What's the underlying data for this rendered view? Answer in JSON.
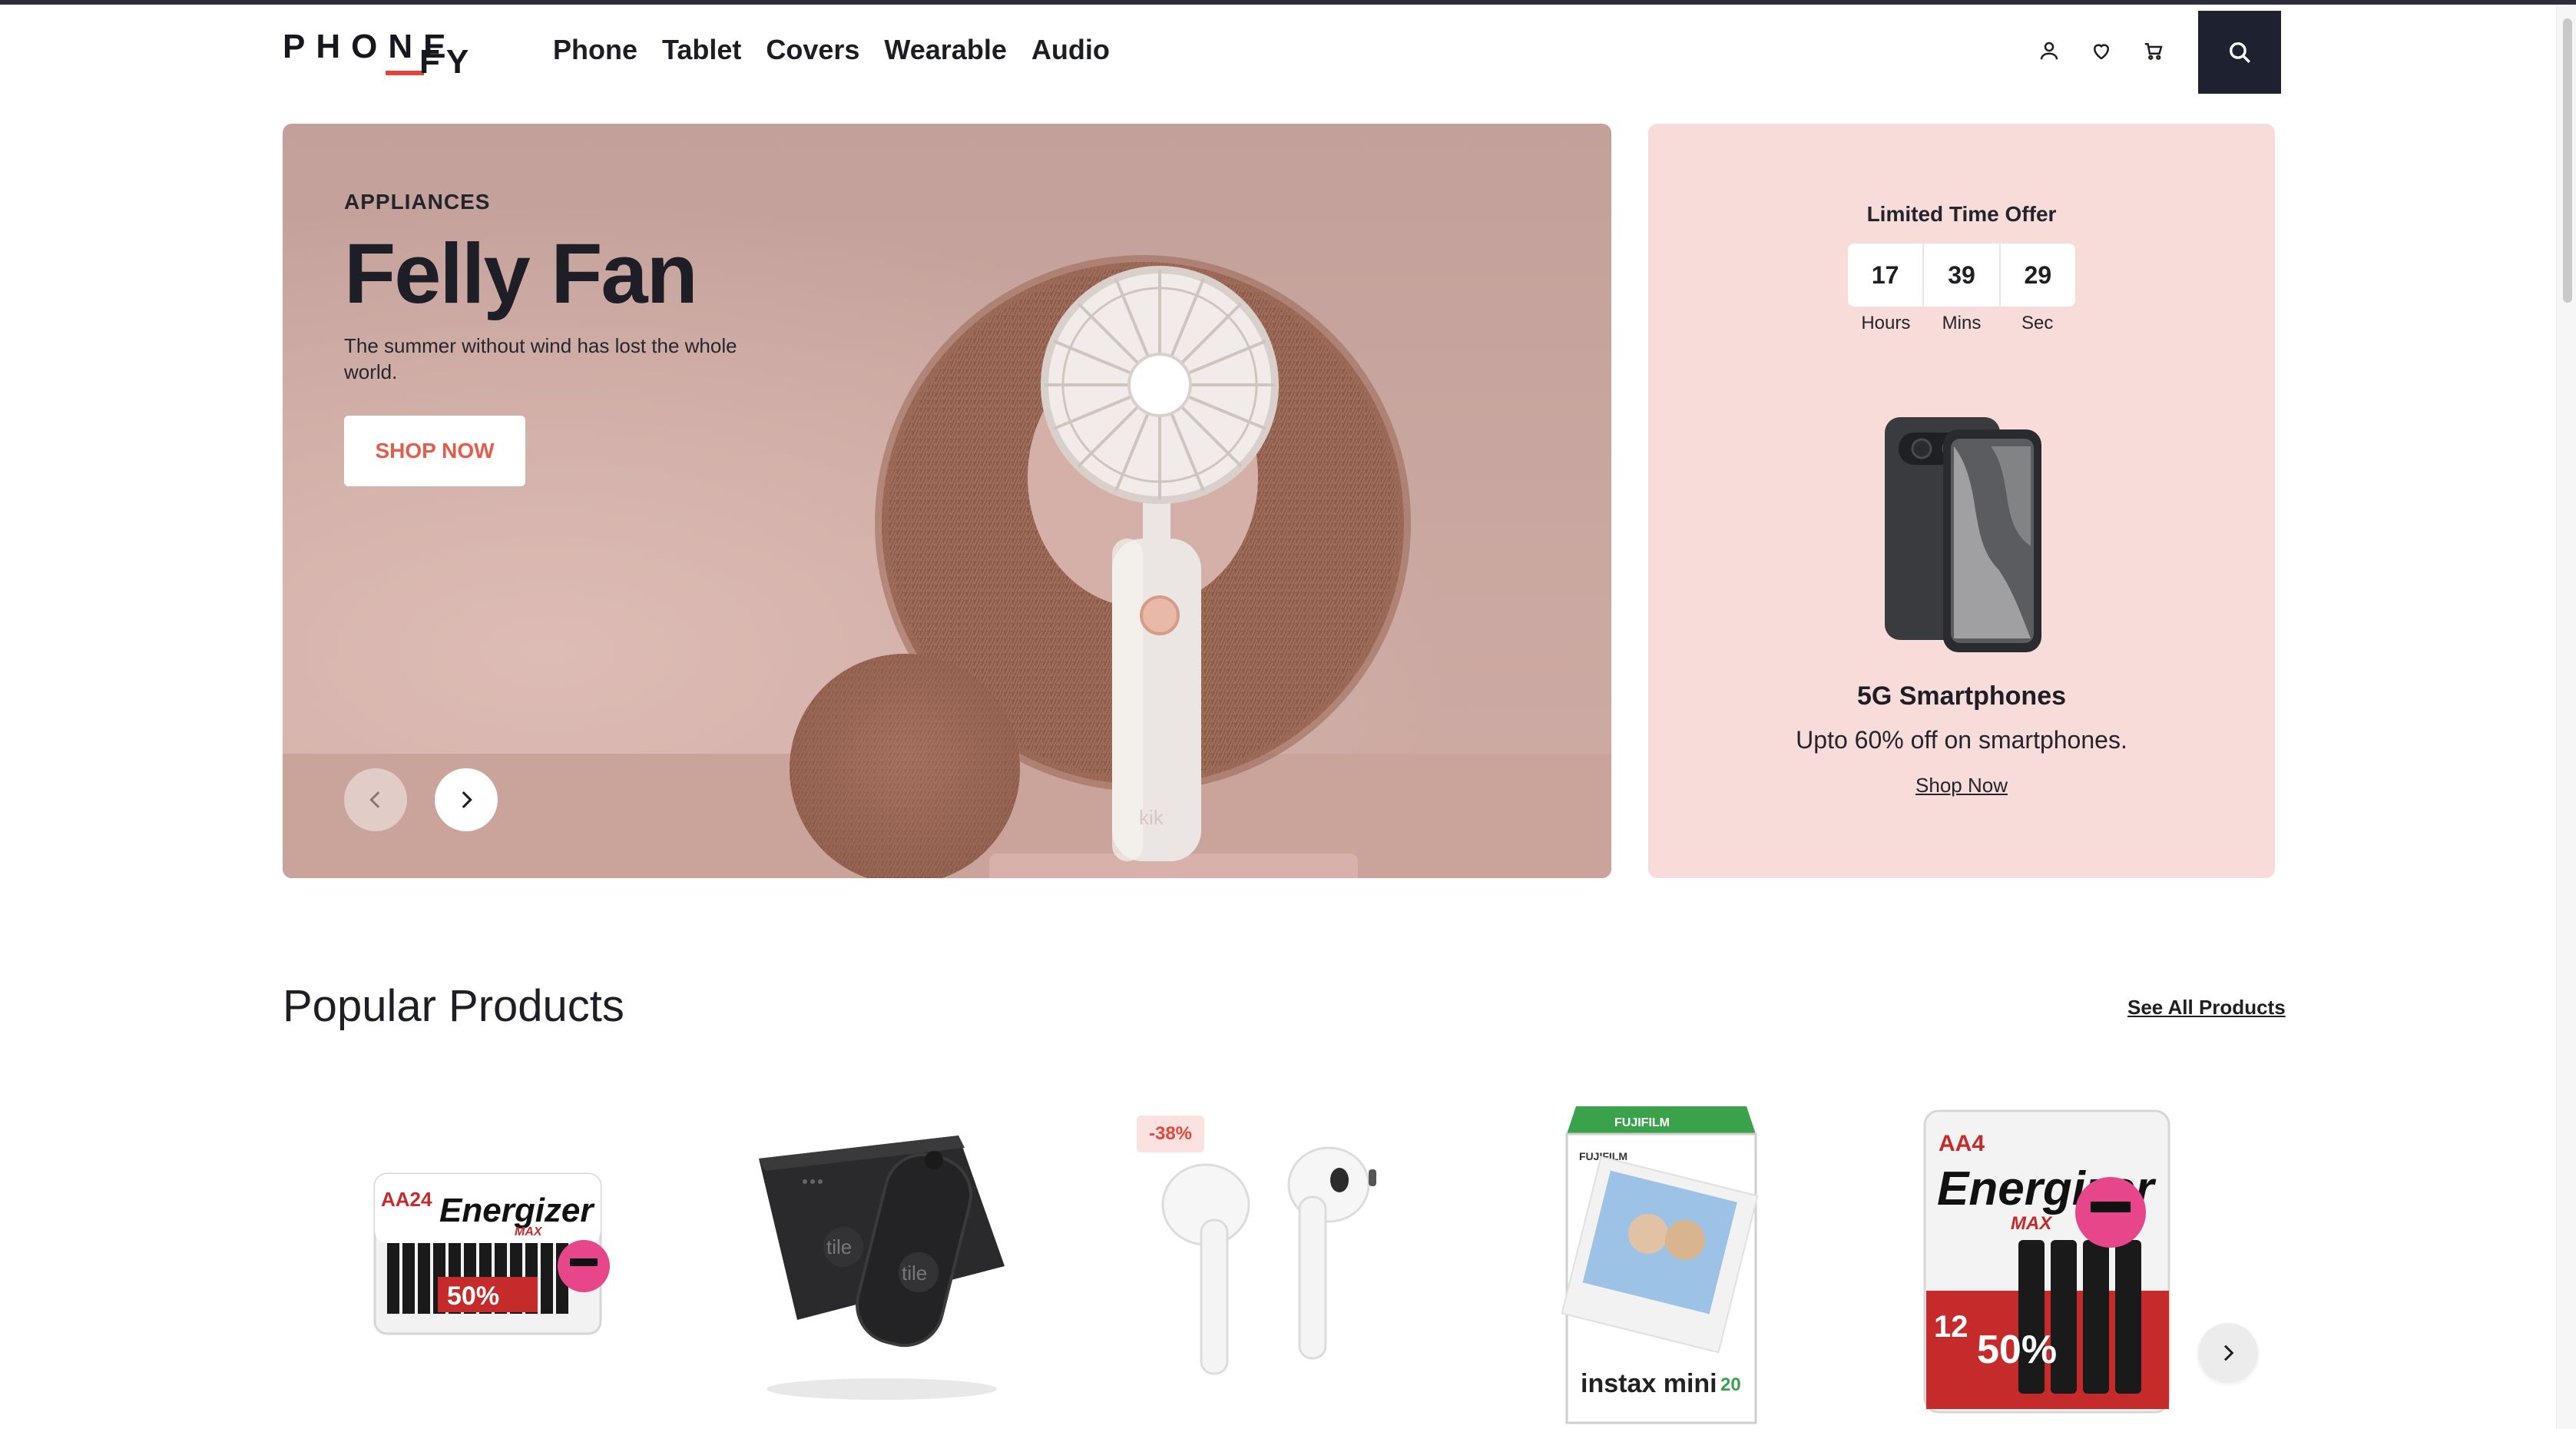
{
  "brand": {
    "logo_text": "PHONEFY",
    "logo_top": "PHONE",
    "logo_fy": "FY",
    "accent": "#e0463a"
  },
  "nav": {
    "items": [
      "Phone",
      "Tablet",
      "Covers",
      "Wearable",
      "Audio"
    ]
  },
  "header_icons": [
    "user-icon",
    "heart-icon",
    "cart-icon",
    "search-icon"
  ],
  "hero": {
    "label": "APPLIANCES",
    "title": "Felly Fan",
    "description": "The summer without wind has lost the whole world.",
    "cta": "SHOP NOW",
    "product_mark": "kik"
  },
  "offer": {
    "title": "Limited Time Offer",
    "countdown": {
      "hours": "17",
      "mins": "39",
      "sec": "29"
    },
    "labels": {
      "hours": "Hours",
      "mins": "Mins",
      "sec": "Sec"
    },
    "heading": "5G Smartphones",
    "subtitle": "Upto 60% off on smartphones.",
    "link": "Shop Now"
  },
  "popular": {
    "title": "Popular Products",
    "see_all": "See All Products",
    "badge": "-38%",
    "products": [
      {
        "name": "energizer-aa24-pack",
        "pack_label": "AA24",
        "brand_text": "Energizer",
        "sub_text": "MAX",
        "promo": "50%"
      },
      {
        "name": "tile-tracker-pack",
        "brand_text": "tile"
      },
      {
        "name": "airpods"
      },
      {
        "name": "instax-mini-film",
        "brand_text": "FUJIFILM",
        "product_text": "instax mini",
        "count": "20"
      },
      {
        "name": "energizer-aa4-pack",
        "pack_label": "AA4",
        "brand_text": "Energizer",
        "sub_text": "MAX",
        "promo": "50%"
      }
    ]
  }
}
